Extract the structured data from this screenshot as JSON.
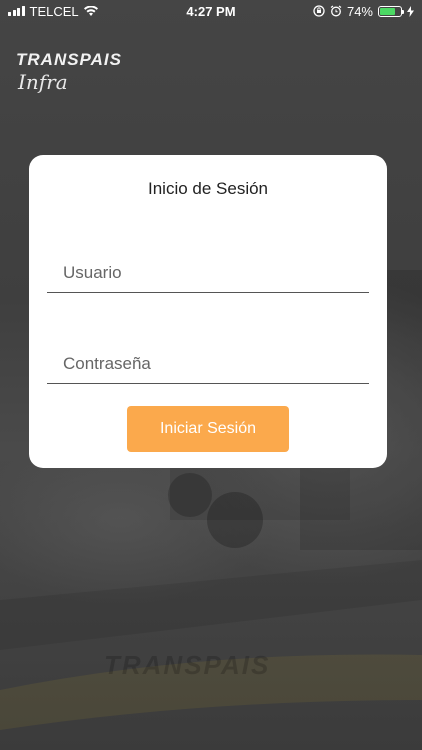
{
  "status_bar": {
    "carrier": "TELCEL",
    "time": "4:27 PM",
    "battery_percent": "74%",
    "battery_level": 0.74,
    "battery_color": "#4cd964"
  },
  "brand": {
    "name": "TRANSPAIS",
    "sub": "Infra"
  },
  "login": {
    "title": "Inicio de Sesión",
    "username_placeholder": "Usuario",
    "username_value": "",
    "password_placeholder": "Contraseña",
    "password_value": "",
    "submit_label": "Iniciar Sesión",
    "accent_color": "#fba94c"
  },
  "icons": {
    "wifi": "wifi-icon",
    "rotation_lock": "rotation-lock-icon",
    "alarm": "alarm-icon",
    "charging": "charging-bolt-icon"
  }
}
